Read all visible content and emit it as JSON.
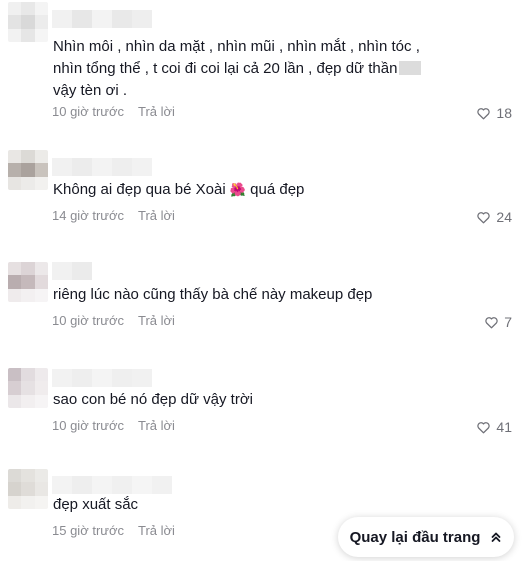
{
  "comments": [
    {
      "text_line1": "Nhìn môi , nhìn da mặt , nhìn mũi , nhìn mắt , nhìn tóc ,",
      "text_line2": "nhìn tổng thể , t coi đi coi lại cả 20 lần , đẹp dữ thần",
      "text_line3": "vậy tèn ơi .",
      "time": "10 giờ trước",
      "reply": "Trả lời",
      "likes": "18"
    },
    {
      "text_before": "Không ai đẹp qua bé Xoài ",
      "emoji": "🌺",
      "text_after": " quá đẹp",
      "time": "14 giờ trước",
      "reply": "Trả lời",
      "likes": "24"
    },
    {
      "text": "riêng lúc nào cũng thấy bà chế này makeup đẹp",
      "time": "10 giờ trước",
      "reply": "Trả lời",
      "likes": "7"
    },
    {
      "text": "sao con bé nó đẹp dữ vậy trời",
      "time": "10 giờ trước",
      "reply": "Trả lời",
      "likes": "41"
    },
    {
      "text": "đẹp xuất sắc",
      "time": "15 giờ trước",
      "reply": "Trả lời"
    }
  ],
  "back_to_top": {
    "label": "Quay lại đầu trang",
    "icon": "double-chevron-up-icon"
  },
  "colors": {
    "text": "#161823",
    "meta": "#8a8b91",
    "blur_light": "#eeeeee",
    "blur_mid": "#d6d6d6"
  }
}
